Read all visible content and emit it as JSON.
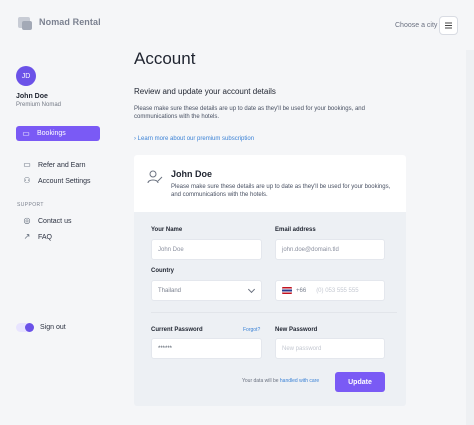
{
  "app": {
    "brand": "Nomad Rental",
    "city_prompt": "Choose a city"
  },
  "sidebar": {
    "avatar_initials": "JD",
    "user_name": "John Doe",
    "user_tier": "Premium Nomad",
    "nav": [
      {
        "label": "Bookings",
        "icon": "card-icon",
        "active": true
      },
      {
        "label": "Refer and Earn",
        "icon": "refer-icon",
        "active": false
      },
      {
        "label": "Account Settings",
        "icon": "user-settings-icon",
        "active": false
      }
    ],
    "support_label": "SUPPORT",
    "support": [
      {
        "label": "Contact us",
        "icon": "globe-icon"
      },
      {
        "label": "FAQ",
        "icon": "external-link-icon"
      }
    ],
    "signout": "Sign out"
  },
  "main": {
    "title": "Account",
    "subtitle": "Review and update your account details",
    "description": "Please make sure these details are up to date as they'll be used for your bookings, and communications with the hotels.",
    "link": "Learn more about our premium subscription",
    "card": {
      "name": "John Doe",
      "description": "Please make sure these details are up to date as they'll be used for your bookings, and communications with the hotels."
    },
    "form": {
      "your_name_label": "Your Name",
      "your_name_value": "John Doe",
      "email_label": "Email address",
      "email_value": "john.doe@domain.tld",
      "country_label": "Country",
      "country_value": "Thailand",
      "phone_code": "+66",
      "phone_placeholder": "(0) 053 555 555",
      "current_password_label": "Current Password",
      "forgot_label": "Forgot?",
      "current_password_value": "******",
      "new_password_label": "New Password",
      "new_password_placeholder": "New password",
      "note_prefix": "Your data will be",
      "note_link": "handled with care",
      "update_button": "Update"
    }
  }
}
